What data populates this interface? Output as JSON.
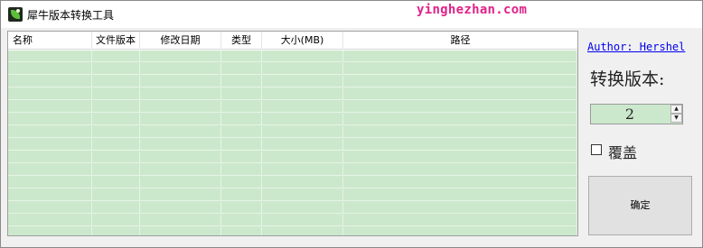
{
  "window": {
    "title": "犀牛版本转换工具",
    "watermark": "yinghezhan.com"
  },
  "listview": {
    "columns": [
      "名称",
      "文件版本",
      "修改日期",
      "类型",
      "大小(MB)",
      "路径"
    ],
    "row_count": 15,
    "row_background": "#cce8cc"
  },
  "sidebar": {
    "author_link": "Author: Hershel",
    "convert_label": "转换版本:",
    "version_value": "2",
    "spin_up_icon": "triangle-up-icon",
    "spin_down_icon": "triangle-down-icon",
    "overwrite_label": "覆盖",
    "overwrite_checked": false,
    "ok_label": "确定"
  },
  "colors": {
    "watermark": "#e0218a",
    "link": "#0000ee",
    "grid_green": "#cce8cc"
  }
}
